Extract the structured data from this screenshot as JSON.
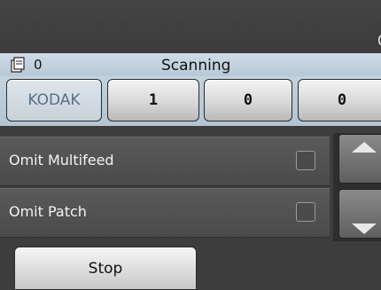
{
  "top": {
    "count": "0"
  },
  "status": {
    "doc_icon": "document-stack-icon",
    "doc_count": "0",
    "text": "Scanning"
  },
  "counters": {
    "brand": "KODAK",
    "values": [
      "1",
      "0",
      "0"
    ]
  },
  "options": [
    {
      "label": "Omit Multifeed",
      "checked": false
    },
    {
      "label": "Omit Patch",
      "checked": false
    }
  ],
  "scroll": {
    "up_icon": "arrow-up-icon",
    "down_icon": "arrow-down-icon"
  },
  "actions": {
    "stop_label": "Stop"
  }
}
